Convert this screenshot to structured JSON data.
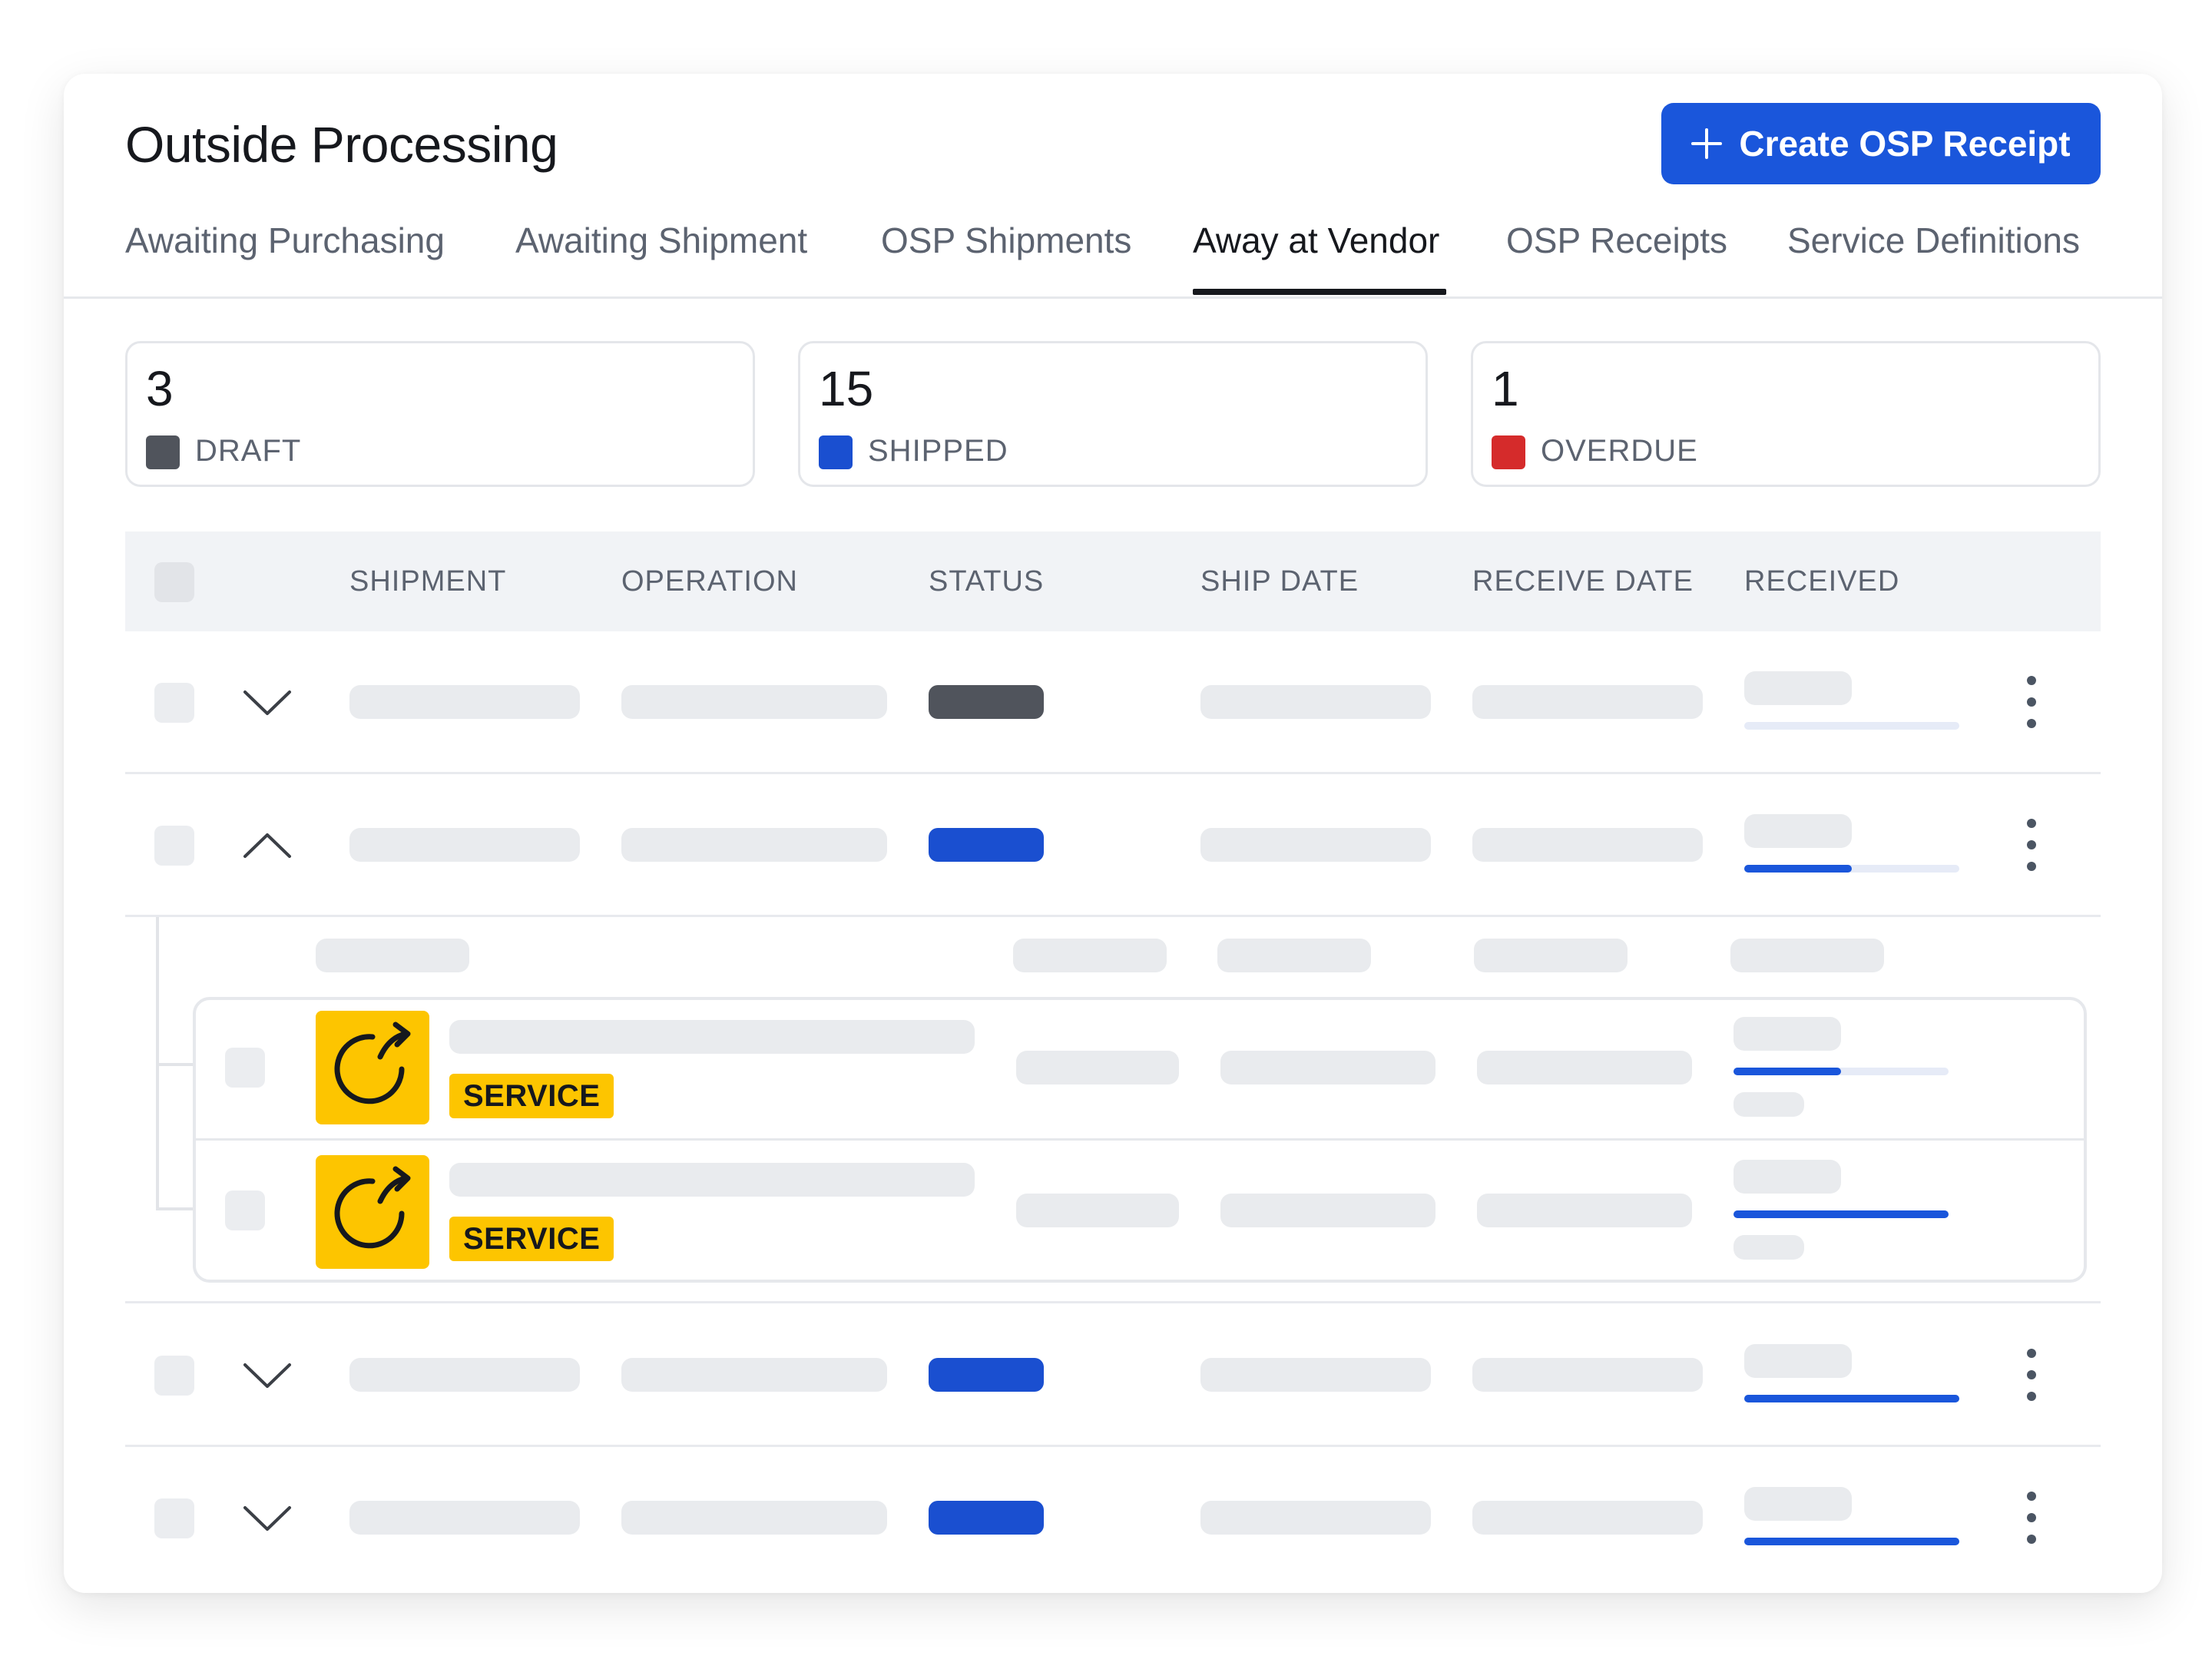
{
  "page": {
    "title": "Outside Processing",
    "create_button_label": "Create OSP Receipt"
  },
  "tabs": [
    {
      "label": "Awaiting Purchasing",
      "active": false
    },
    {
      "label": "Awaiting Shipment",
      "active": false
    },
    {
      "label": "OSP Shipments",
      "active": false
    },
    {
      "label": "Away at Vendor",
      "active": true
    },
    {
      "label": "OSP Receipts",
      "active": false
    },
    {
      "label": "Service Definitions",
      "active": false
    }
  ],
  "stats": [
    {
      "value": "3",
      "label": "DRAFT",
      "color": "#50545c"
    },
    {
      "value": "15",
      "label": "SHIPPED",
      "color": "#1a4fd0"
    },
    {
      "value": "1",
      "label": "OVERDUE",
      "color": "#d52b2b"
    }
  ],
  "table": {
    "columns": [
      "SHIPMENT",
      "OPERATION",
      "STATUS",
      "SHIP DATE",
      "RECEIVE DATE",
      "RECEIVED"
    ],
    "rows": [
      {
        "expanded": false,
        "status_color": "#50545c",
        "received_progress": 0
      },
      {
        "expanded": true,
        "status_color": "#1a4fd0",
        "received_progress": 0.5
      },
      {
        "expanded": false,
        "status_color": "#1a4fd0",
        "received_progress": 1
      },
      {
        "expanded": false,
        "status_color": "#1a4fd0",
        "received_progress": 1
      }
    ],
    "sub_items": [
      {
        "badge": "SERVICE",
        "received_progress": 0.5
      },
      {
        "badge": "SERVICE",
        "received_progress": 1
      }
    ]
  },
  "colors": {
    "accent": "#1a56db",
    "service_yellow": "#fdc500"
  },
  "icons": {
    "create": "plus-icon",
    "expand": "chevron-down-icon",
    "collapse": "chevron-up-icon",
    "row_menu": "kebab-menu-icon",
    "service": "service-cycle-arrow-icon"
  }
}
